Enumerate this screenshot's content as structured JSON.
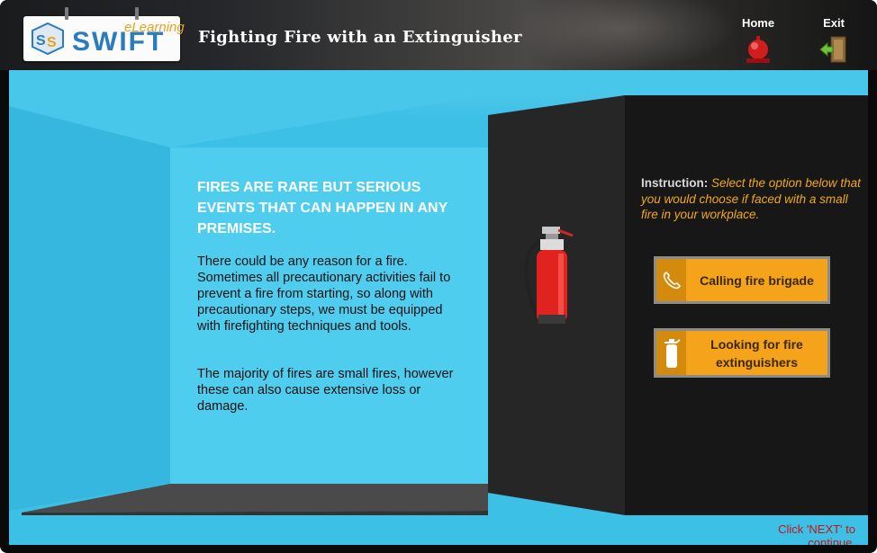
{
  "header": {
    "logo_text": "SWIFT",
    "logo_subtext": "eLearning",
    "course_title": "Fighting Fire with an Extinguisher",
    "home_label": "Home",
    "exit_label": "Exit"
  },
  "content": {
    "heading": "FIRES ARE RARE BUT SERIOUS EVENTS THAT CAN HAPPEN IN ANY PREMISES.",
    "paragraph1": "There could be any reason for a fire. Sometimes all precautionary activities fail to prevent a fire from starting, so along with precautionary steps, we must be equipped with firefighting techniques and tools.",
    "paragraph2": "The majority of fires are small fires, however these can also cause extensive loss or damage."
  },
  "panel": {
    "instruction_label": "Instruction:",
    "instruction_text": "Select the option below that you would choose if faced with a small fire in your workplace.",
    "options": [
      {
        "label": "Calling fire brigade",
        "icon": "phone-icon"
      },
      {
        "label": "Looking for fire extinguishers",
        "icon": "fire-extinguisher-icon"
      }
    ]
  },
  "footer": {
    "next_message": "Click 'NEXT' to continue."
  },
  "colors": {
    "accent_orange": "#f4a31a",
    "stage_blue": "#3cc0e6",
    "panel_dark": "#1a1a1a",
    "next_red": "#c81414"
  }
}
